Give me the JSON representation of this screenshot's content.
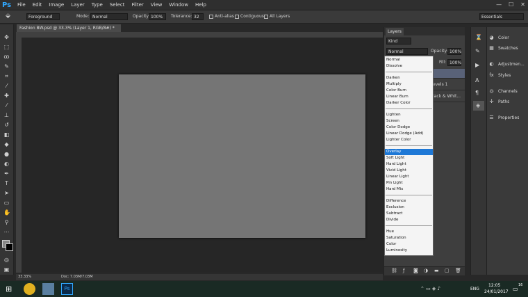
{
  "app": {
    "logo": "Ps"
  },
  "menu": [
    "File",
    "Edit",
    "Image",
    "Layer",
    "Type",
    "Select",
    "Filter",
    "View",
    "Window",
    "Help"
  ],
  "window_controls": [
    "—",
    "☐",
    "✕"
  ],
  "options": {
    "fill_source": "Foreground",
    "mode_label": "Mode:",
    "mode_value": "Normal",
    "opacity_label": "Opacity:",
    "opacity_value": "100%",
    "tolerance_label": "Tolerance:",
    "tolerance_value": "32",
    "antialias": "Anti-alias",
    "contiguous": "Contiguous",
    "all_layers": "All Layers",
    "workspace": "Essentials"
  },
  "document": {
    "tab_title": "Fashion BW.psd @ 33.3% (Layer 1, RGB/8#) *",
    "zoom": "33.33%",
    "doc_size": "Doc: 7.03M/7.03M"
  },
  "layers_panel": {
    "tab": "Layers",
    "kind": "Kind",
    "blend_value": "Normal",
    "opacity_label": "Opacity:",
    "opacity_value": "100%",
    "fill_label": "Fill:",
    "fill_value": "100%",
    "rows": [
      "evels 1",
      "lack & Whit..."
    ]
  },
  "blend_modes": {
    "groups": [
      [
        "Normal",
        "Dissolve"
      ],
      [
        "Darken",
        "Multiply",
        "Color Burn",
        "Linear Burn",
        "Darker Color"
      ],
      [
        "Lighten",
        "Screen",
        "Color Dodge",
        "Linear Dodge (Add)",
        "Lighter Color"
      ],
      [
        "Overlay",
        "Soft Light",
        "Hard Light",
        "Vivid Light",
        "Linear Light",
        "Pin Light",
        "Hard Mix"
      ],
      [
        "Difference",
        "Exclusion",
        "Subtract",
        "Divide"
      ],
      [
        "Hue",
        "Saturation",
        "Color",
        "Luminosity"
      ]
    ],
    "selected": "Overlay"
  },
  "dock": {
    "items": [
      "Color",
      "Swatches",
      "Adjustmen...",
      "Styles",
      "Channels",
      "Paths",
      "Properties"
    ]
  },
  "taskbar": {
    "language": "ENG",
    "time": "12:05",
    "date": "24/01/2017",
    "notification_count": "16"
  },
  "colors": {
    "accent": "#1e78d6",
    "ps_blue": "#31a8ff"
  }
}
